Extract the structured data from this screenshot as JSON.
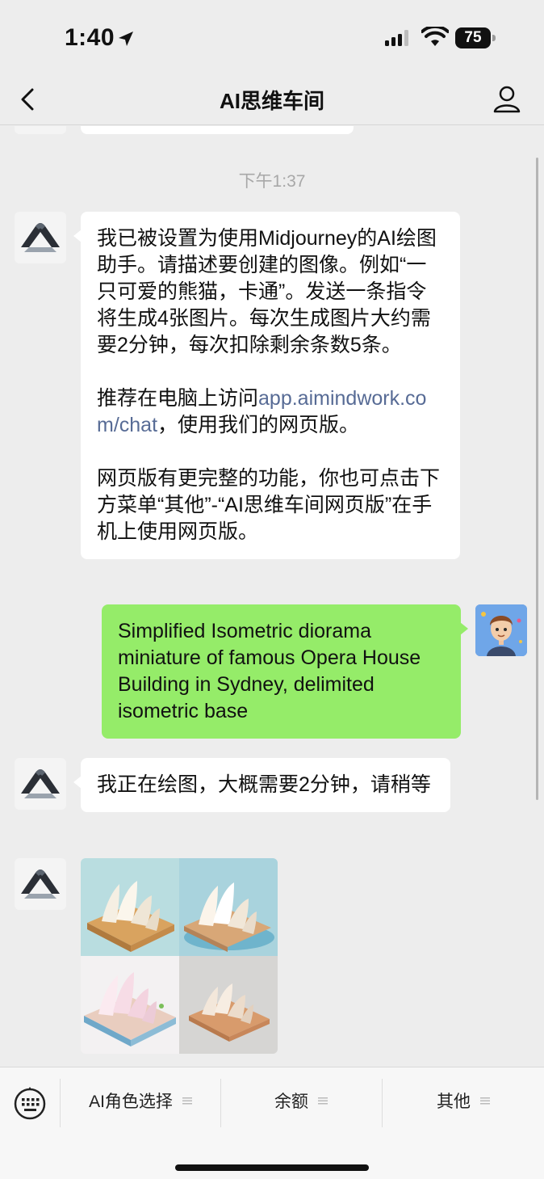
{
  "status_bar": {
    "time": "1:40",
    "battery": "75"
  },
  "nav": {
    "title": "AI思维车间"
  },
  "chat": {
    "timestamp": "下午1:37",
    "messages": [
      {
        "sender": "bot",
        "paragraphs": [
          "我已被设置为使用Midjourney的AI绘图助手。请描述要创建的图像。例如“一只可爱的熊猫，卡通”。发送一条指令将生成4张图片。每次生成图片大约需要2分钟，每次扣除剩余条数5条。",
          "网页版有更完整的功能，你也可点击下方菜单“其他”-“AI思维车间网页版”在手机上使用网页版。"
        ],
        "link_prefix": "推荐在电脑上访问",
        "link_text": "app.aimindwork.com/chat",
        "link_suffix": "，使用我们的网页版。"
      },
      {
        "sender": "user",
        "text": "Simplified Isometric diorama miniature of famous Opera House Building in Sydney, delimited isometric base"
      },
      {
        "sender": "bot",
        "text": "我正在绘图，大概需要2分钟，请稍等"
      },
      {
        "sender": "bot",
        "image": "opera-house-isometric-grid-4"
      }
    ]
  },
  "bottom_menu": {
    "items": [
      {
        "label": "AI角色选择"
      },
      {
        "label": "余额"
      },
      {
        "label": "其他"
      }
    ]
  },
  "colors": {
    "background": "#ededed",
    "user_bubble": "#95ec69",
    "bot_bubble": "#ffffff",
    "link": "#576b95"
  }
}
